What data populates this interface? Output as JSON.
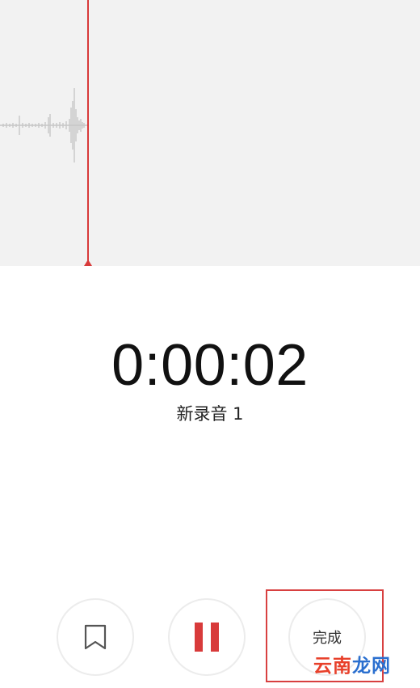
{
  "recorder": {
    "elapsed_time": "0:00:02",
    "recording_name": "新录音 1",
    "done_label": "完成"
  },
  "watermark": {
    "part1": "云南",
    "part2": "龙网"
  },
  "icons": {
    "bookmark": "bookmark-icon",
    "pause": "pause-icon"
  },
  "colors": {
    "accent": "#d83a3a",
    "waveform_bg": "#f2f2f2",
    "waveform_bars": "#c8c8c8",
    "watermark_red": "#e8402a",
    "watermark_blue": "#2a6fcf"
  }
}
